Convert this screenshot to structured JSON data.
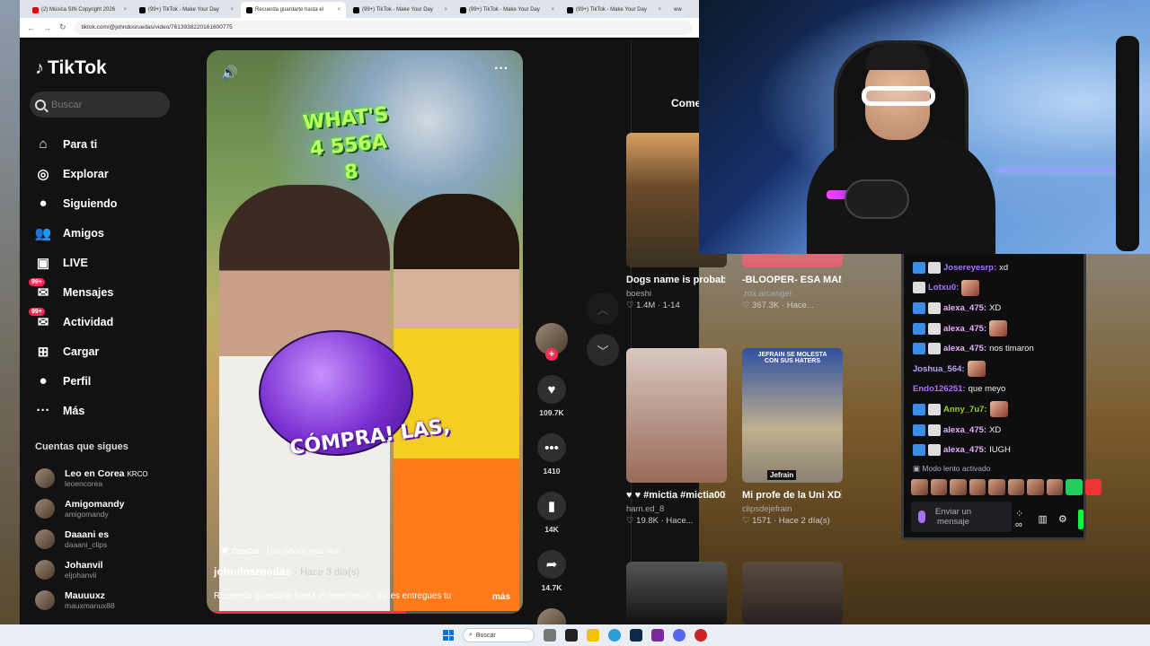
{
  "browser": {
    "tabs": [
      {
        "title": "(2) Música SIN Copyright 2026",
        "fav": "yt",
        "active": false
      },
      {
        "title": "(99+) TikTok - Make Your Day",
        "fav": "tt",
        "active": false
      },
      {
        "title": "Recuerda guardarte hasta el",
        "fav": "tt",
        "active": true
      },
      {
        "title": "(99+) TikTok - Make Your Day",
        "fav": "tt",
        "active": false
      },
      {
        "title": "(99+) TikTok - Make Your Day",
        "fav": "tt",
        "active": false
      },
      {
        "title": "(99+) TikTok - Make Your Day",
        "fav": "tt",
        "active": false
      }
    ],
    "tab_partial": "ww",
    "url": "tiktok.com/@johndosruedas/video/7613938220161600775"
  },
  "tiktok": {
    "logo_text": "TikTok",
    "search_placeholder": "Buscar",
    "menu": [
      {
        "label": "Para ti",
        "icon": "home-icon",
        "glyph": "⌂"
      },
      {
        "label": "Explorar",
        "icon": "compass-icon",
        "glyph": "◎"
      },
      {
        "label": "Siguiendo",
        "icon": "avatar-icon",
        "glyph": "●"
      },
      {
        "label": "Amigos",
        "icon": "friends-icon",
        "glyph": "👥"
      },
      {
        "label": "LIVE",
        "icon": "live-icon",
        "glyph": "▣"
      },
      {
        "label": "Mensajes",
        "icon": "messages-icon",
        "glyph": "✉",
        "badge": "99+"
      },
      {
        "label": "Actividad",
        "icon": "activity-icon",
        "glyph": "✉",
        "badge": "99+"
      },
      {
        "label": "Cargar",
        "icon": "upload-icon",
        "glyph": "⊞"
      },
      {
        "label": "Perfil",
        "icon": "profile-icon",
        "glyph": "●"
      },
      {
        "label": "Más",
        "icon": "more-icon",
        "glyph": "···"
      }
    ],
    "following_header": "Cuentas que sigues",
    "following": [
      {
        "name": "Leo en Corea",
        "tag": "KRCO",
        "handle": "leoencorea"
      },
      {
        "name": "Amigomandy",
        "tag": "",
        "handle": "amigomandy"
      },
      {
        "name": "Daaani es",
        "tag": "",
        "handle": "daaani_clips"
      },
      {
        "name": "Johanvil",
        "tag": "",
        "handle": "eljohanvii"
      },
      {
        "name": "Mauuuxz",
        "tag": "",
        "handle": "mauxmanux88"
      }
    ],
    "video": {
      "sticker_top": "WHAT'S 4 556A 8",
      "sticker_bottom": "CÓMPRA! LAS,",
      "capcut_brand": "CapCut",
      "capcut_text": "· Una edición más fácil",
      "author": "johndosruedas",
      "posted": "· Hace 3 día(s)",
      "description": "Recuerda guardarte hasta el matrimonio, no les entregues tu",
      "more": "más",
      "progress": 0.63
    },
    "actions": [
      {
        "name": "like",
        "glyph": "♥",
        "count": "109.7K"
      },
      {
        "name": "comment",
        "glyph": "•••",
        "count": "1410"
      },
      {
        "name": "bookmark",
        "glyph": "▮",
        "count": "14K"
      },
      {
        "name": "share",
        "glyph": "➦",
        "count": "14.7K"
      }
    ],
    "comments_tab": "Come",
    "grid": [
      {
        "title": "Dogs name is probably cupcak...",
        "user": "boeshi",
        "stats": "♡ 1.4M  ·  1-14"
      },
      {
        "title": "-BLOOPER- ESA MANO...",
        "user": ".rox.arcangel",
        "stats": "♡ 367.3K  ·  Hace..."
      },
      {
        "title": "♥ ♥ #mictia #mictia00...",
        "user": "ham.ed_8",
        "stats": "♡ 19.8K  ·  Hace..."
      },
      {
        "title": "Mi profe de la Uni XD! #jefrain...",
        "user": "clipsdejefrain",
        "stats": "♡ 1571  ·  Hace 2 día(s)"
      }
    ],
    "grid_overlays": {
      "jefrain_banner": "JEFRAIN SE MOLESTA CON SUS HATERS",
      "jefrain_tag": "Jefrain"
    }
  },
  "chat": {
    "messages": [
      {
        "user": "Josereyesrp",
        "color": "#a970ff",
        "text": "xd",
        "badges": 2
      },
      {
        "user": "Lotxu0",
        "color": "#a970ff",
        "text": "",
        "emote": true,
        "badges": 1
      },
      {
        "user": "alexa_475",
        "color": "#e9b0ff",
        "text": "XD",
        "badges": 2
      },
      {
        "user": "alexa_475",
        "color": "#e9b0ff",
        "text": "",
        "emote": true,
        "badges": 2
      },
      {
        "user": "alexa_475",
        "color": "#e9b0ff",
        "text": "nos timaron",
        "badges": 2
      },
      {
        "user": "Joshua_564",
        "color": "#bfa0ff",
        "text": "",
        "emote": true,
        "badges": 0
      },
      {
        "user": "Endo126251",
        "color": "#a970ff",
        "text": "que meyo",
        "badges": 0
      },
      {
        "user": "Anny_7u7",
        "color": "#9acd32",
        "text": "",
        "emote": true,
        "badges": 2
      },
      {
        "user": "alexa_475",
        "color": "#e9b0ff",
        "text": "XD",
        "badges": 2
      },
      {
        "user": "alexa_475",
        "color": "#e9b0ff",
        "text": "IUGH",
        "badges": 2
      }
    ],
    "slow_mode": "Modo lento activado",
    "input_placeholder": "Enviar un mensaje"
  },
  "taskbar": {
    "search": "Buscar"
  }
}
